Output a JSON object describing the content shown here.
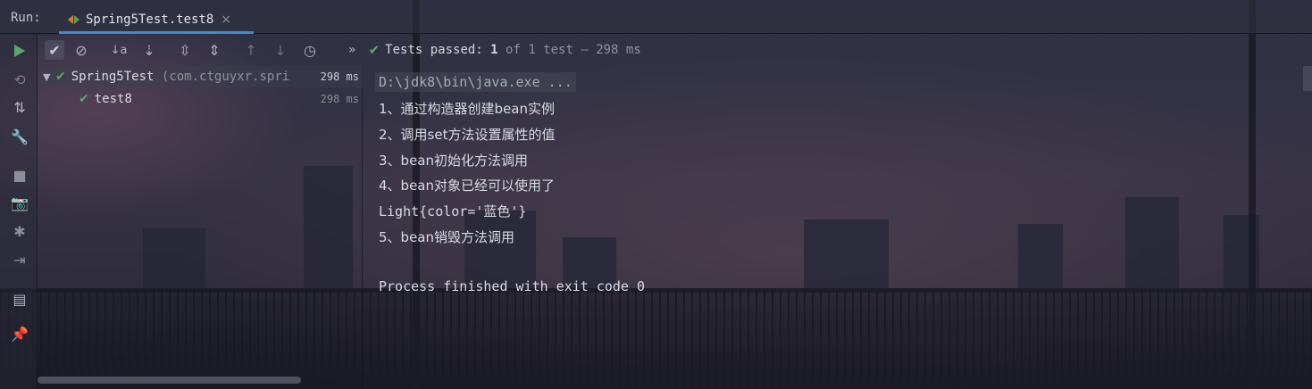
{
  "run_tab": {
    "run_label": "Run:",
    "tab_title": "Spring5Test.test8",
    "close_glyph": "×"
  },
  "toolbar": {
    "status_prefix": "Tests passed:",
    "status_passed": "1",
    "status_suffix": "of 1 test – 298 ms",
    "overflow_glyph": "»"
  },
  "tree": {
    "root": {
      "name": "Spring5Test",
      "package": "(com.ctguyxr.spri",
      "time": "298 ms"
    },
    "child": {
      "name": "test8",
      "time": "298 ms"
    }
  },
  "console": {
    "lines": [
      "D:\\jdk8\\bin\\java.exe ...",
      "1、通过构造器创建bean实例",
      "2、调用set方法设置属性的值",
      "3、bean初始化方法调用",
      "4、bean对象已经可以使用了",
      "Light{color='蓝色'}",
      "5、bean销毁方法调用",
      "",
      "Process finished with exit code 0"
    ]
  },
  "colors": {
    "accent": "#4a88c7",
    "pass_green": "#59a869"
  },
  "icons": [
    "run-icon",
    "check-icon",
    "cancel-icon",
    "sort-alpha-icon",
    "sort-duration-icon",
    "expand-all-icon",
    "collapse-all-icon",
    "prev-failed-icon",
    "next-failed-icon",
    "history-icon",
    "rerun-icon",
    "toggle-icon",
    "settings-icon",
    "stop-icon",
    "camera-icon",
    "debug-icon",
    "exit-icon",
    "layout-icon",
    "pin-icon"
  ]
}
